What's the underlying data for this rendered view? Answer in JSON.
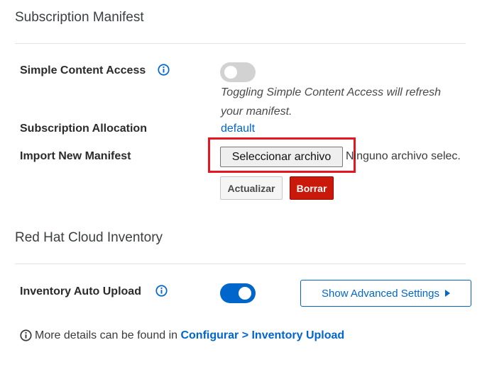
{
  "subscription": {
    "title": "Subscription Manifest",
    "simple_content_access": {
      "label": "Simple Content Access",
      "enabled": false,
      "help_line1": "Toggling Simple Content Access will refresh",
      "help_line2": "your manifest."
    },
    "allocation": {
      "label": "Subscription Allocation",
      "value": "default"
    },
    "import": {
      "label": "Import New Manifest",
      "choose_file_label": "Seleccionar archivo",
      "no_file_text": "Ninguno archivo selec.",
      "update_label": "Actualizar",
      "delete_label": "Borrar"
    }
  },
  "inventory": {
    "title": "Red Hat Cloud Inventory",
    "auto_upload": {
      "label": "Inventory Auto Upload",
      "enabled": true
    },
    "advanced_button_label": "Show Advanced Settings",
    "footer": {
      "text": "More details can be found in",
      "link_label": "Configurar > Inventory Upload"
    }
  },
  "colors": {
    "accent": "#0066cc",
    "toggle_on": "#0066cc",
    "toggle_off": "#d2d2d2",
    "danger": "#c9190b",
    "highlight": "#e8141f"
  },
  "icons": {
    "info": "info-circle-icon",
    "caret": "caret-right-icon"
  }
}
